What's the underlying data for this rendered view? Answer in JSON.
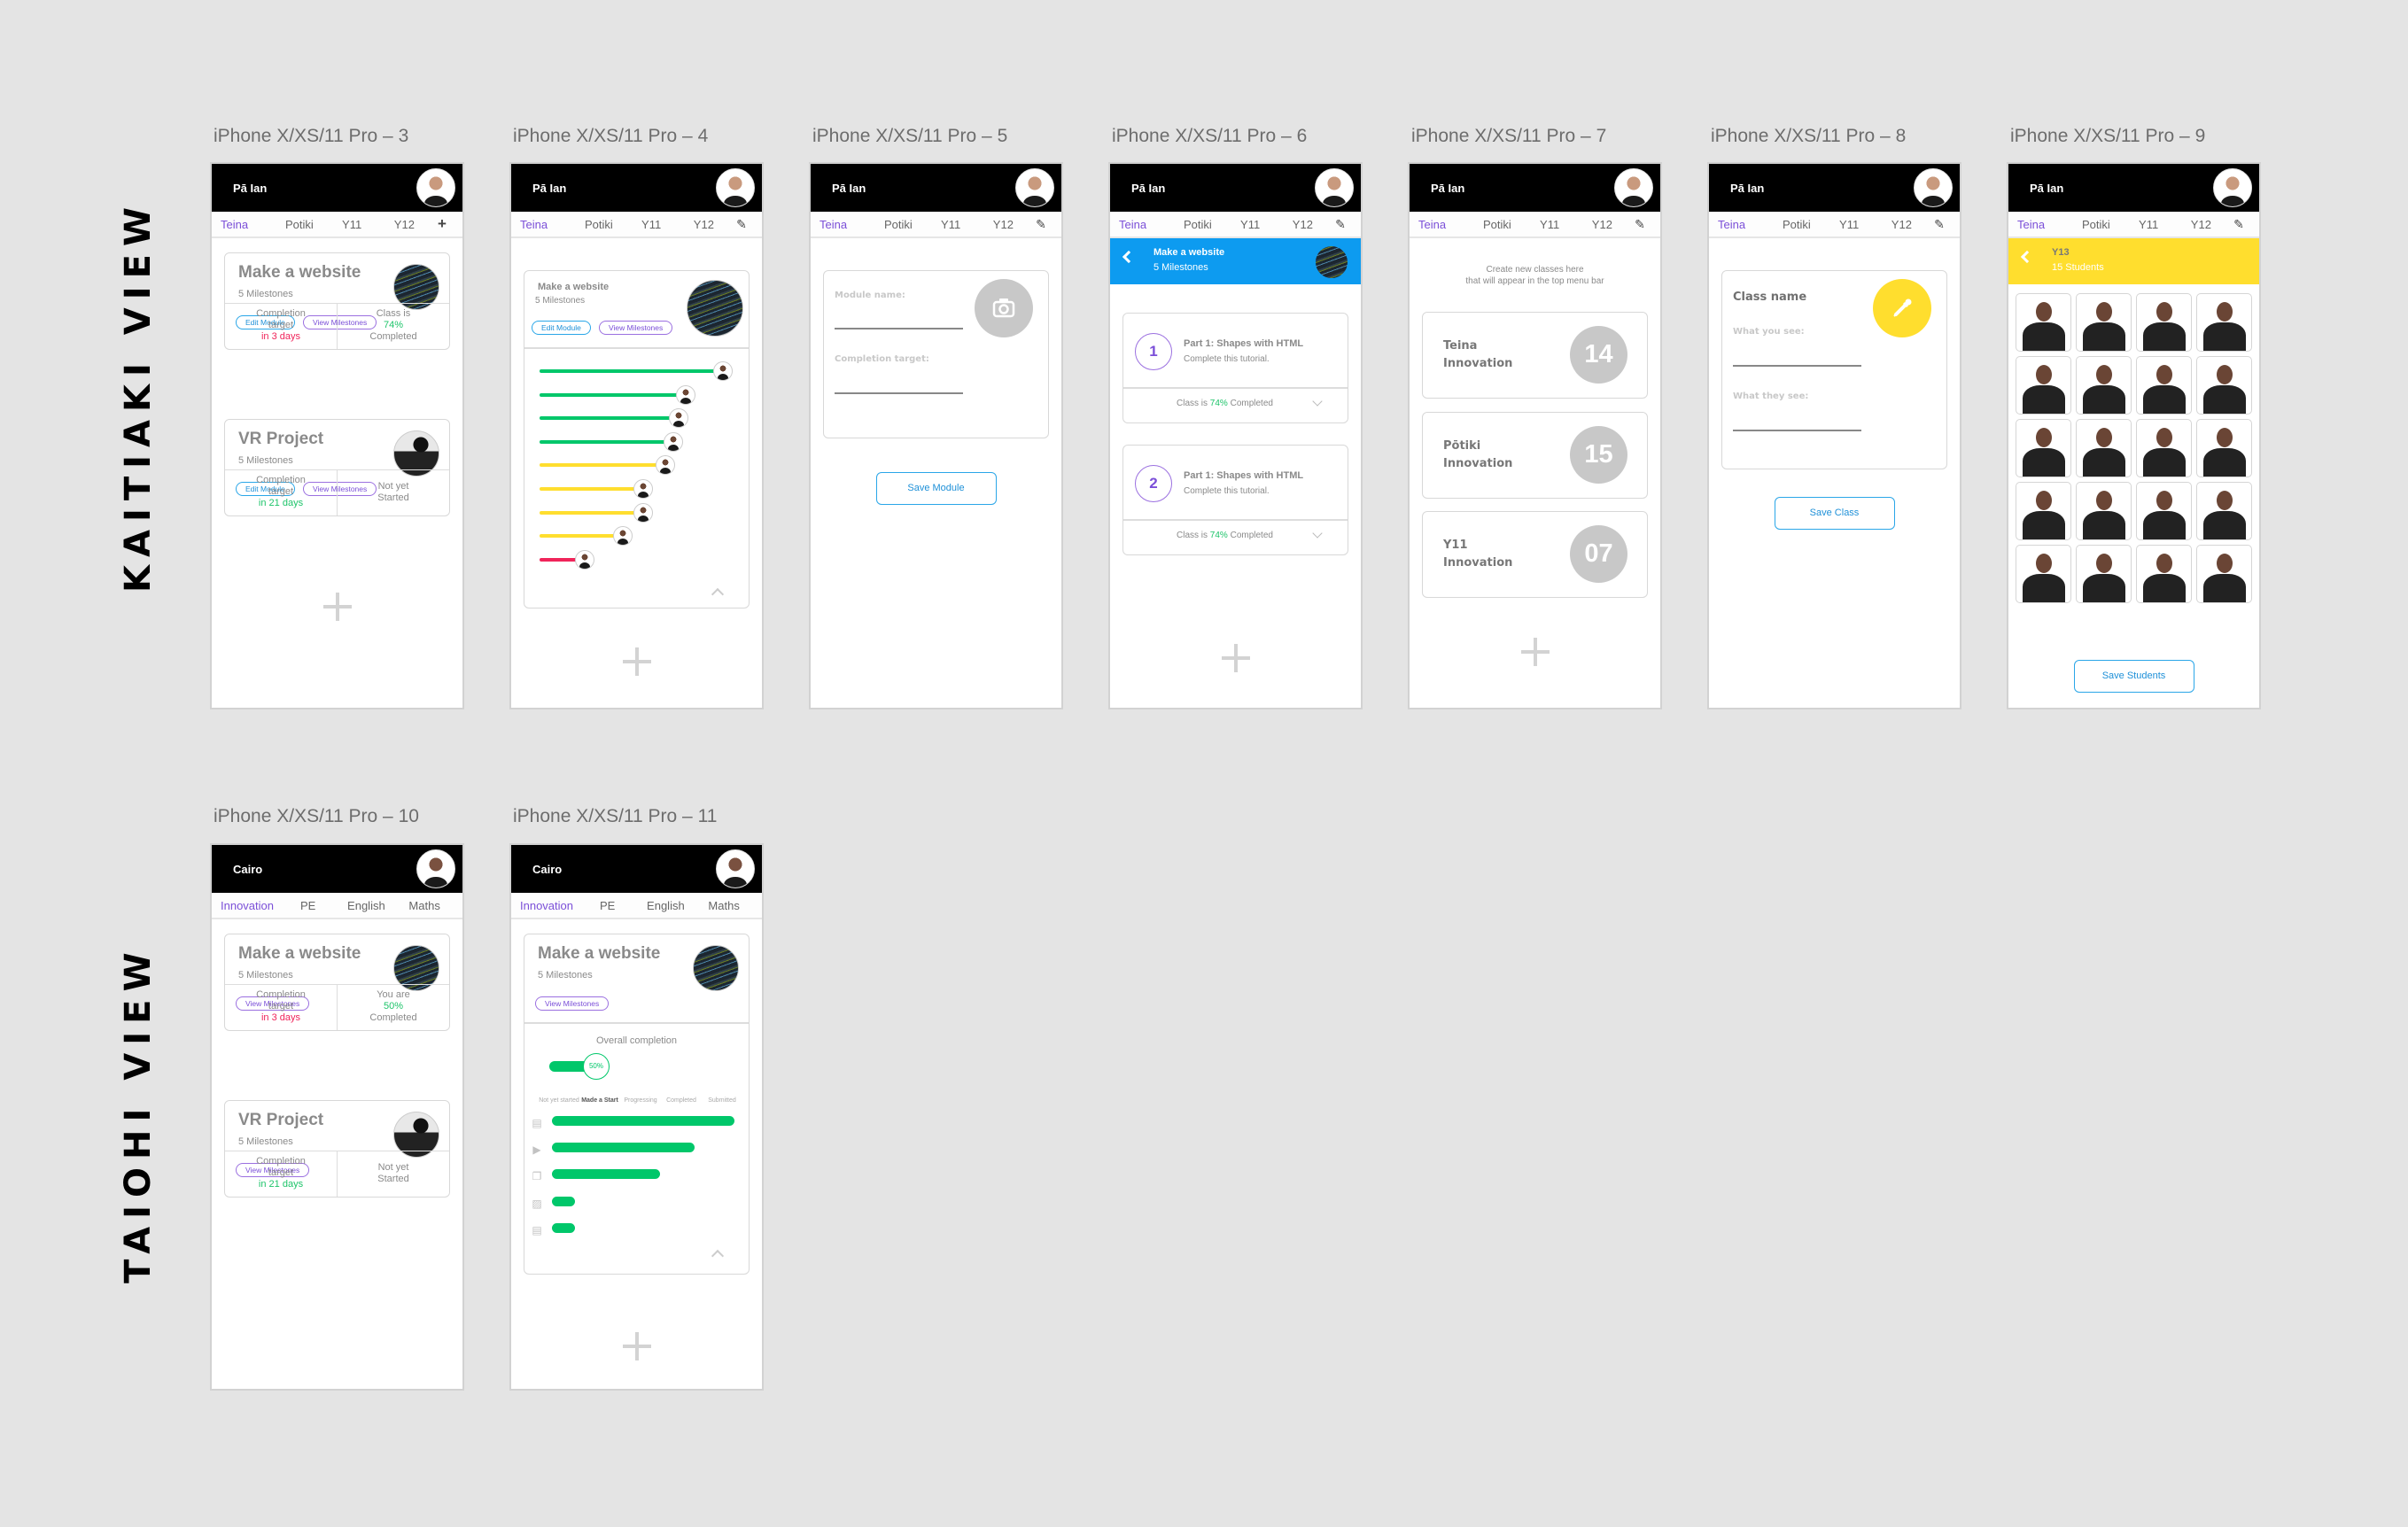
{
  "sections": {
    "kaitiaki": "KAITIAKI VIEW",
    "taiohi": "TAIOHI VIEW"
  },
  "colors": {
    "accent_purple": "#7b4fd8",
    "accent_blue": "#1e90d8",
    "header_blue": "#0d9bf0",
    "banner_yellow": "#ffde2e",
    "progress_green": "#00c76a",
    "progress_yellow": "#ffde2e",
    "progress_red": "#f0245a"
  },
  "teacher": {
    "name": "Pā Ian"
  },
  "student": {
    "name": "Cairo"
  },
  "teacher_tabs": [
    "Teina",
    "Potiki",
    "Y11",
    "Y12"
  ],
  "student_tabs": [
    "Innovation",
    "PE",
    "English",
    "Maths"
  ],
  "frames": {
    "f3": {
      "label": "iPhone X/XS/11 Pro – 3",
      "modules": [
        {
          "title": "Make a website",
          "milestones": "5 Milestones",
          "edit": "Edit Module",
          "view": "View Milestones",
          "target_l1": "Completion",
          "target_l2": "target",
          "target_due": "in 3 days",
          "status_l1": "Class is",
          "status_pct": "74%",
          "status_l3": "Completed"
        },
        {
          "title": "VR Project",
          "milestones": "5 Milestones",
          "edit": "Edit Module",
          "view": "View Milestones",
          "target_l1": "Completion",
          "target_l2": "target",
          "target_due": "in 21 days",
          "status_l1": "Not yet",
          "status_l2": "Started"
        }
      ]
    },
    "f4": {
      "label": "iPhone X/XS/11 Pro – 4",
      "module": {
        "title": "Make a website",
        "milestones": "5 Milestones",
        "edit": "Edit Module",
        "view": "View Milestones"
      },
      "student_progress": [
        {
          "progress": 0.96,
          "status": "green"
        },
        {
          "progress": 0.76,
          "status": "green"
        },
        {
          "progress": 0.72,
          "status": "green"
        },
        {
          "progress": 0.69,
          "status": "green"
        },
        {
          "progress": 0.65,
          "status": "yellow"
        },
        {
          "progress": 0.53,
          "status": "yellow"
        },
        {
          "progress": 0.53,
          "status": "yellow"
        },
        {
          "progress": 0.42,
          "status": "yellow"
        },
        {
          "progress": 0.21,
          "status": "red"
        }
      ]
    },
    "f5": {
      "label": "iPhone X/XS/11 Pro – 5",
      "module_name_label": "Module name:",
      "completion_target_label": "Completion target:",
      "save": "Save Module"
    },
    "f6": {
      "label": "iPhone X/XS/11 Pro – 6",
      "banner_title": "Make a website",
      "banner_sub": "5 Milestones",
      "milestones": [
        {
          "num": "1",
          "title": "Part 1: Shapes with HTML",
          "desc": "Complete this tutorial.",
          "pre": "Class is",
          "pct": "74%",
          "post": "Completed"
        },
        {
          "num": "2",
          "title": "Part 1: Shapes with HTML",
          "desc": "Complete this tutorial.",
          "pre": "Class is",
          "pct": "74%",
          "post": "Completed"
        }
      ]
    },
    "f7": {
      "label": "iPhone X/XS/11 Pro – 7",
      "hint_l1": "Create new classes here",
      "hint_l2": "that will appear in the top menu bar",
      "classes": [
        {
          "l1": "Teina",
          "l2": "Innovation",
          "count": "14"
        },
        {
          "l1": "Pōtiki",
          "l2": "Innovation",
          "count": "15"
        },
        {
          "l1": "Y11",
          "l2": "Innovation",
          "count": "07"
        }
      ]
    },
    "f8": {
      "label": "iPhone X/XS/11 Pro – 8",
      "class_name": "Class name",
      "you_see": "What you see:",
      "they_see": "What they see:",
      "save": "Save Class"
    },
    "f9": {
      "label": "iPhone X/XS/11 Pro – 9",
      "banner_title": "Y13",
      "banner_sub": "15 Students",
      "student_count": 20,
      "save": "Save Students"
    },
    "f10": {
      "label": "iPhone X/XS/11 Pro – 10",
      "modules": [
        {
          "title": "Make a website",
          "milestones": "5 Milestones",
          "view": "View Milestones",
          "target_l1": "Completion",
          "target_l2": "target",
          "target_due": "in 3 days",
          "status_l1": "You are",
          "status_pct": "50%",
          "status_l3": "Completed"
        },
        {
          "title": "VR Project",
          "milestones": "5 Milestones",
          "view": "View Milestones",
          "target_l1": "Completion",
          "target_l2": "target",
          "target_due": "in 21 days",
          "status_l1": "Not yet",
          "status_l2": "Started"
        }
      ]
    },
    "f11": {
      "label": "iPhone X/XS/11 Pro – 11",
      "module": {
        "title": "Make a website",
        "milestones": "5 Milestones",
        "view": "View Milestones"
      },
      "overall_label": "Overall completion",
      "overall_pct": "50%",
      "overall_value": 0.5,
      "stages": [
        "Not yet started",
        "Made a Start",
        "Progressing",
        "Completed",
        "Submitted"
      ],
      "current_stage": "Made a Start",
      "milestone_bars": [
        {
          "icon": "document-icon",
          "progress": 1.0
        },
        {
          "icon": "video-icon",
          "progress": 0.78
        },
        {
          "icon": "chat-icon",
          "progress": 0.59
        },
        {
          "icon": "image-icon",
          "progress": 0.12
        },
        {
          "icon": "document-icon",
          "progress": 0.12
        }
      ]
    }
  }
}
